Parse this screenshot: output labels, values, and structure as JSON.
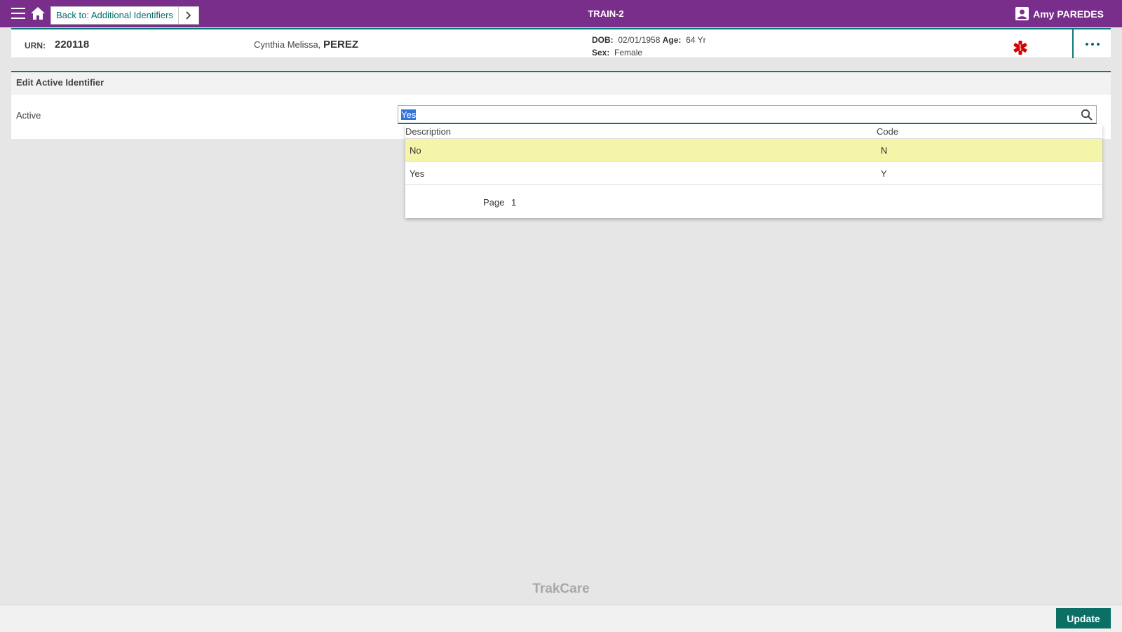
{
  "header": {
    "back_label": "Back to: Additional Identifiers",
    "app_title": "TRAIN-2",
    "user_name": "Amy PAREDES",
    "icons": [
      "menu-icon",
      "home-icon",
      "chevron-right-icon",
      "user-icon"
    ]
  },
  "patient": {
    "urn_label": "URN:",
    "urn": "220118",
    "given_names": "Cynthia Melissa,",
    "surname": "PEREZ",
    "dob_label": "DOB:",
    "dob": "02/01/1958",
    "age_label": "Age:",
    "age": "64 Yr",
    "sex_label": "Sex:",
    "sex": "Female",
    "alert_icon_color": "#d40000"
  },
  "form": {
    "title": "Edit Active Identifier",
    "active_label": "Active",
    "active_value": "Yes"
  },
  "lookup": {
    "columns": [
      "Description",
      "Code"
    ],
    "rows": [
      {
        "description": "No",
        "code": "N",
        "highlighted": true
      },
      {
        "description": "Yes",
        "code": "Y",
        "highlighted": false
      }
    ],
    "page_label": "Page",
    "page_number": "1"
  },
  "footer": {
    "brand": "TrakCare",
    "update_label": "Update"
  },
  "colors": {
    "topbar": "#7a2e8c",
    "accent": "#0c7a74",
    "highlight_row": "#f5f5aa"
  }
}
